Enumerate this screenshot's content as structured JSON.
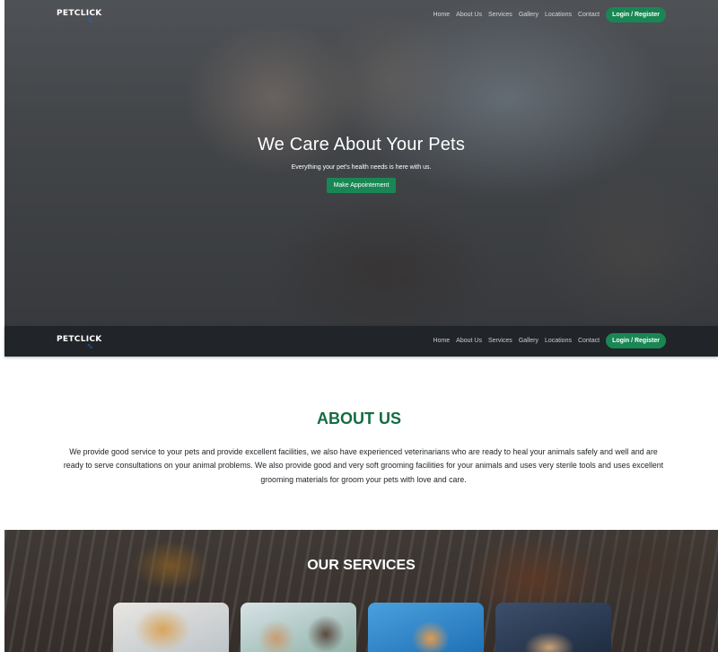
{
  "brand": {
    "logo_text": "PETCLICK",
    "paw_glyph": "🐾"
  },
  "nav": {
    "items": [
      "Home",
      "About Us",
      "Services",
      "Gallery",
      "Locations",
      "Contact"
    ],
    "login_label": "Login / Register"
  },
  "hero": {
    "title": "We Care About Your Pets",
    "subtitle": "Everything your pet's health needs is here with us.",
    "cta_label": "Make Appointement"
  },
  "about": {
    "title": "ABOUT US",
    "text": "We provide good service to your pets and provide excellent facilities, we also have experienced veterinarians who are ready to heal your animals safely and well and are ready to serve consultations on your animal problems. We also provide good and very soft grooming facilities for your animals and uses very sterile tools and uses excellent grooming materials for groom your pets with love and care."
  },
  "services": {
    "title": "OUR SERVICES",
    "cards": [
      "dog-grooming-image",
      "vet-checkup-image",
      "kitten-vaccination-image",
      "pet-surgery-image"
    ]
  },
  "colors": {
    "brand_green": "#198754",
    "heading_green": "#146c43",
    "navbar_dark": "#212529"
  }
}
